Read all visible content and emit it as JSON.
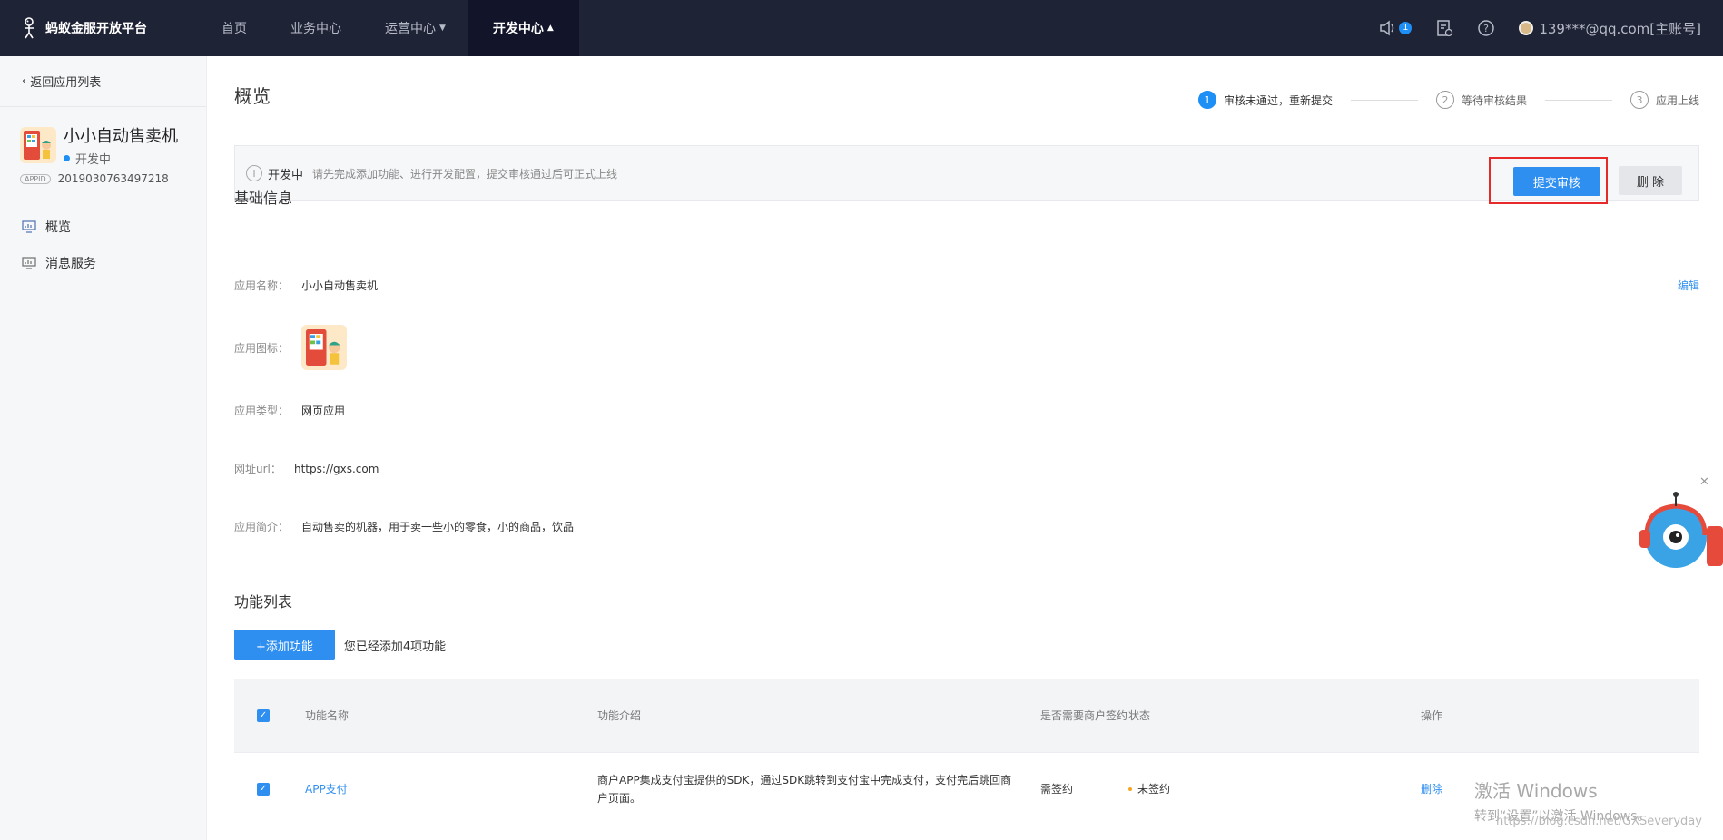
{
  "topbar": {
    "brand": "蚂蚁金服开放平台",
    "nav": [
      {
        "label": "首页"
      },
      {
        "label": "业务中心"
      },
      {
        "label": "运营中心"
      },
      {
        "label": "开发中心"
      }
    ],
    "notification_count": "1",
    "account": "139***@qq.com[主账号]"
  },
  "sidebar": {
    "back": "返回应用列表",
    "app_name": "小小自动售卖机",
    "app_status": "开发中",
    "appid_tag": "APPID",
    "appid": "2019030763497218",
    "menu": [
      {
        "label": "概览"
      },
      {
        "label": "消息服务"
      }
    ]
  },
  "main": {
    "title": "概览",
    "steps": [
      {
        "num": "1",
        "label": "审核未通过，重新提交"
      },
      {
        "num": "2",
        "label": "等待审核结果"
      },
      {
        "num": "3",
        "label": "应用上线"
      }
    ],
    "notice": {
      "icon": "i",
      "status": "开发中",
      "text": "请先完成添加功能、进行开发配置，提交审核通过后可正式上线",
      "submit_label": "提交审核",
      "delete_label": "删 除"
    },
    "basic_info_title": "基础信息",
    "edit_label": "编辑",
    "fields": {
      "name_label": "应用名称：",
      "name_value": "小小自动售卖机",
      "icon_label": "应用图标：",
      "type_label": "应用类型：",
      "type_value": "网页应用",
      "url_label": "网址url：",
      "url_value": "https://gxs.com",
      "desc_label": "应用简介：",
      "desc_value": "自动售卖的机器，用于卖一些小的零食，小的商品，饮品"
    },
    "function_list_title": "功能列表",
    "add_button": "+添加功能",
    "add_hint": "您已经添加4项功能",
    "table": {
      "headers": {
        "name": "功能名称",
        "desc": "功能介绍",
        "sign": "是否需要商户签约",
        "status": "状态",
        "op": "操作"
      },
      "rows": [
        {
          "name": "APP支付",
          "desc": "商户APP集成支付宝提供的SDK，通过SDK跳转到支付宝中完成支付，支付完后跳回商户页面。",
          "sign": "需签约",
          "status": "未签约",
          "op": "删除"
        }
      ]
    }
  },
  "watermark": {
    "title": "激活 Windows",
    "sub": "转到“设置”以激活 Windows。",
    "csdn": "https://blog.csdn.net/GXSeveryday"
  },
  "colors": {
    "topbar_bg": "#1f2336",
    "accent": "#2f8ff0",
    "highlight": "#e62a2a"
  }
}
